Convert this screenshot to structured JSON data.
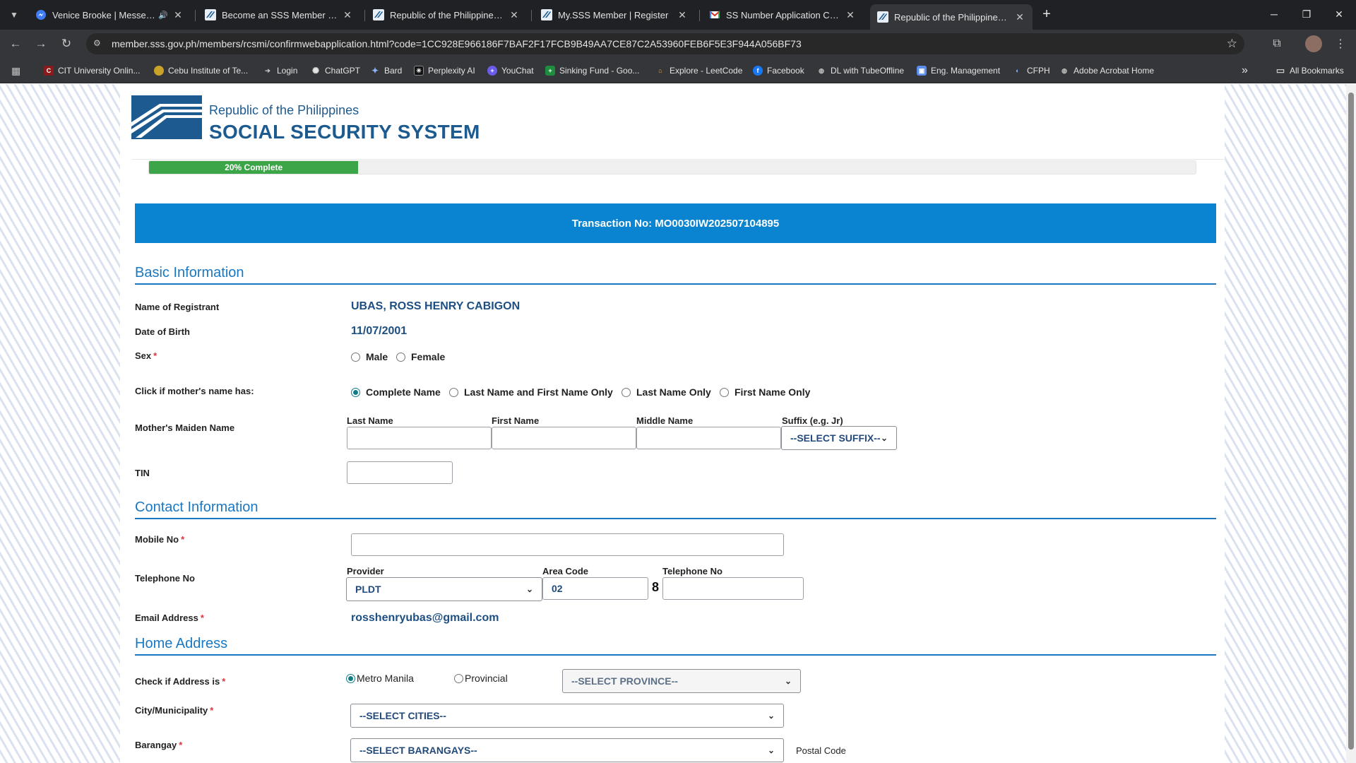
{
  "browser": {
    "tabs": [
      {
        "title": "Venice Brooke | Messenger",
        "muted_icon": "🔊"
      },
      {
        "title": "Become an SSS Member | Repu"
      },
      {
        "title": "Republic of the Philippines Soci"
      },
      {
        "title": "My.SSS Member | Register"
      },
      {
        "title": "SS Number Application Continu"
      },
      {
        "title": "Republic of the Philippines Soci"
      }
    ],
    "url": "member.sss.gov.ph/members/rcsmi/confirmwebapplication.html?code=1CC928E966186F7BAF2F17FCB9B49AA7CE87C2A53960FEB6F5E3F944A056BF73",
    "bookmarks": [
      "CIT University Onlin...",
      "Cebu Institute of Te...",
      "Login",
      "ChatGPT",
      "Bard",
      "Perplexity AI",
      "YouChat",
      "Sinking Fund - Goo...",
      "Explore - LeetCode",
      "Facebook",
      "DL with TubeOffline",
      "Eng. Management",
      "CFPH",
      "Adobe Acrobat Home"
    ],
    "all_bookmarks": "All Bookmarks",
    "more": "»"
  },
  "header": {
    "subtitle": "Republic of the Philippines",
    "title": "SOCIAL SECURITY SYSTEM"
  },
  "progress": {
    "label": "20% Complete",
    "fraction": 0.2
  },
  "transaction": "Transaction No: MO0030IW202507104895",
  "basic": {
    "title": "Basic Information",
    "name_label": "Name of Registrant",
    "name_value": "UBAS, ROSS HENRY CABIGON",
    "dob_label": "Date of Birth",
    "dob_value": "11/07/2001",
    "sex_label": "Sex",
    "sex_options": [
      "Male",
      "Female"
    ],
    "mother_opt_label": "Click if mother's name has:",
    "mother_opts": [
      "Complete Name",
      "Last Name and First Name Only",
      "Last Name Only",
      "First Name Only"
    ],
    "maiden_label": "Mother's Maiden Name",
    "maiden_cols": [
      "Last Name",
      "First Name",
      "Middle Name",
      "Suffix (e.g. Jr)"
    ],
    "suffix_select": "--SELECT SUFFIX--",
    "tin_label": "TIN"
  },
  "contact": {
    "title": "Contact Information",
    "mobile_label": "Mobile No",
    "tel_label": "Telephone No",
    "provider_label": "Provider",
    "provider_value": "PLDT",
    "area_label": "Area Code",
    "area_value": "02",
    "prefix": "8",
    "telno_label": "Telephone No",
    "email_label": "Email Address",
    "email_value": "rosshenryubas@gmail.com"
  },
  "home": {
    "title": "Home Address",
    "check_label": "Check if Address is",
    "opt_metro": "Metro Manila",
    "opt_prov": "Provincial",
    "province_select": "--SELECT PROVINCE--",
    "city_label": "City/Municipality",
    "city_select": "--SELECT CITIES--",
    "brgy_label": "Barangay",
    "brgy_select": "--SELECT BARANGAYS--",
    "postal_label": "Postal Code"
  },
  "colors": {
    "brand": "#1d5a8f",
    "accent": "#0a84d0",
    "progress": "#3ca548",
    "required": "#d9363e"
  }
}
